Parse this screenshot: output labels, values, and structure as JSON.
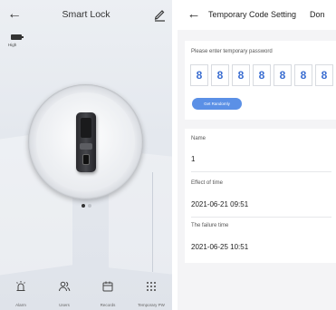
{
  "left_screen": {
    "title": "Smart Lock",
    "back_icon": "arrow-left-icon",
    "edit_icon": "pen-icon",
    "battery": {
      "icon": "battery-icon",
      "label": "High"
    },
    "carousel": {
      "pages": 2,
      "active": 1
    },
    "nav": [
      {
        "label": "Alarm",
        "icon": "alarm-icon"
      },
      {
        "label": "Users",
        "icon": "users-icon"
      },
      {
        "label": "Records",
        "icon": "calendar-icon"
      },
      {
        "label": "Temporary PW",
        "icon": "keypad-icon"
      }
    ]
  },
  "right_screen": {
    "title": "Temporary Code Setting",
    "done_label": "Don",
    "back_icon": "arrow-left-icon",
    "password_label": "Please enter temporary password",
    "digits": [
      "8",
      "8",
      "8",
      "8",
      "8",
      "8",
      "8"
    ],
    "random_button": "Get Randomly",
    "name": {
      "label": "Name",
      "value": "1"
    },
    "effect_time": {
      "label": "Effect of time",
      "value": "2021-06-21 09:51"
    },
    "failure_time": {
      "label": "The failure time",
      "value": "2021-06-25 10:51"
    }
  }
}
